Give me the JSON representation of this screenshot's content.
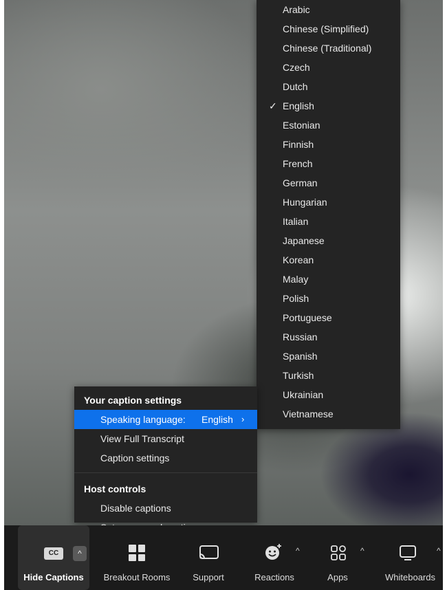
{
  "language_menu": {
    "selected": "English",
    "check_glyph": "✓",
    "items": [
      "Arabic",
      "Chinese (Simplified)",
      "Chinese (Traditional)",
      "Czech",
      "Dutch",
      "English",
      "Estonian",
      "Finnish",
      "French",
      "German",
      "Hungarian",
      "Italian",
      "Japanese",
      "Korean",
      "Malay",
      "Polish",
      "Portuguese",
      "Russian",
      "Spanish",
      "Turkish",
      "Ukrainian",
      "Vietnamese"
    ]
  },
  "caption_menu": {
    "section_caption": "Your caption settings",
    "speaking_language_label": "Speaking language:",
    "speaking_language_value": "English",
    "view_transcript": "View Full Transcript",
    "caption_settings": "Caption settings",
    "section_host": "Host controls",
    "disable_captions": "Disable captions",
    "manual_captioner": "Set up manual captioner..."
  },
  "toolbar": {
    "hide_captions": "Hide Captions",
    "cc_text": "CC",
    "breakout_rooms": "Breakout Rooms",
    "support": "Support",
    "reactions": "Reactions",
    "apps": "Apps",
    "whiteboards": "Whiteboards",
    "caret": "^"
  },
  "colors": {
    "menu_bg": "#242424",
    "highlight": "#0e71eb",
    "toolbar_bg": "#1b1b1b"
  }
}
